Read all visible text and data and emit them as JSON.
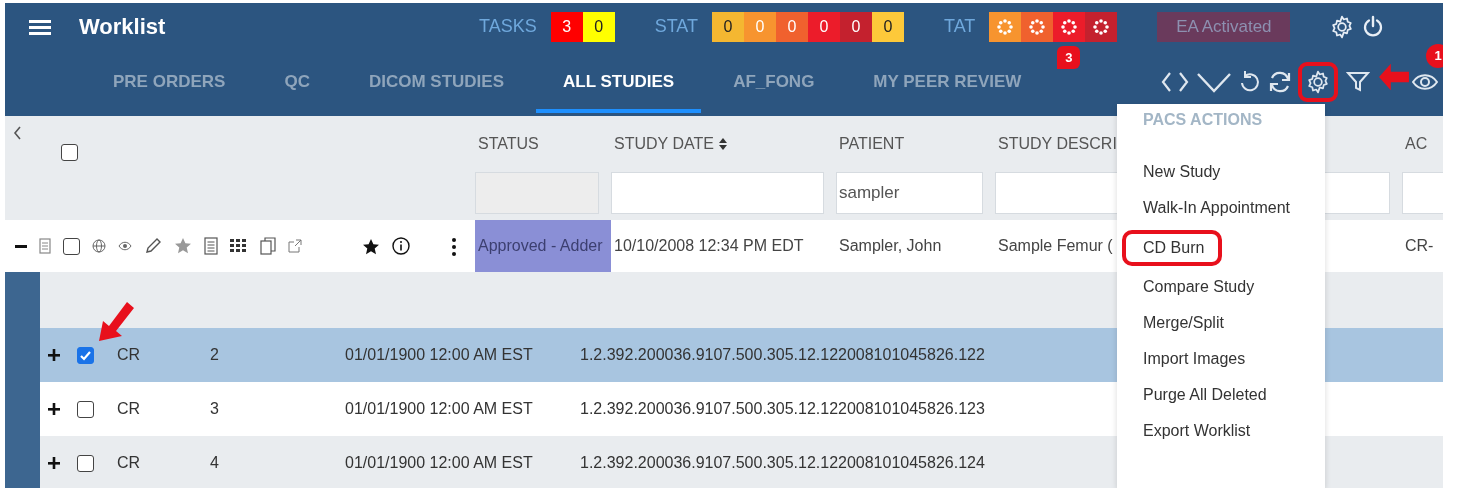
{
  "header": {
    "title": "Worklist",
    "counters": [
      {
        "label": "TASKS",
        "cells": [
          {
            "text": "3",
            "color": "#ff0000"
          },
          {
            "text": "0",
            "color": "#ffff00"
          }
        ]
      },
      {
        "label": "STAT",
        "cells": [
          {
            "text": "0",
            "color": "#f4b731"
          },
          {
            "text": "0",
            "color": "#f7942f"
          },
          {
            "text": "0",
            "color": "#f0612e"
          },
          {
            "text": "0",
            "color": "#ec1c2a"
          },
          {
            "text": "0",
            "color": "#c4212e"
          },
          {
            "text": "0",
            "color": "#fdc93a"
          }
        ]
      },
      {
        "label": "TAT",
        "cells": [
          {
            "color": "#f7942f"
          },
          {
            "color": "#f0612e"
          },
          {
            "color": "#ec1c2a"
          },
          {
            "color": "#c4212e"
          }
        ]
      }
    ],
    "ea_button": "EA Activated"
  },
  "tabs": [
    {
      "label": "PRE ORDERS",
      "selected": false
    },
    {
      "label": "QC",
      "selected": false
    },
    {
      "label": "DICOM STUDIES",
      "selected": false
    },
    {
      "label": "ALL STUDIES",
      "selected": true
    },
    {
      "label": "AF_FONG",
      "selected": false
    },
    {
      "label": "MY PEER REVIEW",
      "selected": false,
      "badge": "3"
    }
  ],
  "toolbar": {
    "settings_circled": true,
    "badge": "1"
  },
  "grid": {
    "all_checked": false,
    "columns": [
      {
        "label": "STATUS",
        "sortable": false,
        "filter_disabled": true
      },
      {
        "label": "STUDY DATE",
        "sortable": true,
        "filter_disabled": false
      },
      {
        "label": "PATIENT",
        "sortable": false,
        "filter_disabled": false,
        "value": "sampler"
      },
      {
        "label": "STUDY DESCRI",
        "sortable": false,
        "filter_disabled": false
      },
      {
        "filter_disabled": false
      },
      {
        "label": "AC",
        "sortable": false,
        "filter_disabled": false
      }
    ],
    "study": {
      "expanded": true,
      "checked": false,
      "status": "Approved - Adder",
      "study_date": "10/10/2008 12:34 PM EDT",
      "patient": "Sampler, John",
      "description": "Sample Femur (",
      "accession": "CR-"
    },
    "series": [
      {
        "expanded": false,
        "checked": true,
        "selected": true,
        "modality": "CR",
        "number": "2",
        "date": "01/01/1900 12:00 AM EST",
        "uid": "1.2.392.200036.9107.500.305.12.122008101045826.122"
      },
      {
        "expanded": false,
        "checked": false,
        "selected": false,
        "modality": "CR",
        "number": "3",
        "date": "01/01/1900 12:00 AM EST",
        "uid": "1.2.392.200036.9107.500.305.12.122008101045826.123"
      },
      {
        "expanded": false,
        "checked": false,
        "selected": false,
        "modality": "CR",
        "number": "4",
        "date": "01/01/1900 12:00 AM EST",
        "uid": "1.2.392.200036.9107.500.305.12.122008101045826.124"
      }
    ]
  },
  "menu": {
    "title": "PACS ACTIONS",
    "items": [
      {
        "label": "New Study",
        "circled": false
      },
      {
        "label": "Walk-In Appointment",
        "circled": false
      },
      {
        "label": "CD Burn",
        "circled": true
      },
      {
        "label": "Compare Study",
        "circled": false
      },
      {
        "label": "Merge/Split",
        "circled": false
      },
      {
        "label": "Import Images",
        "circled": false
      },
      {
        "label": "Purge All Deleted",
        "circled": false
      },
      {
        "label": "Export Worklist",
        "circled": false
      }
    ]
  }
}
